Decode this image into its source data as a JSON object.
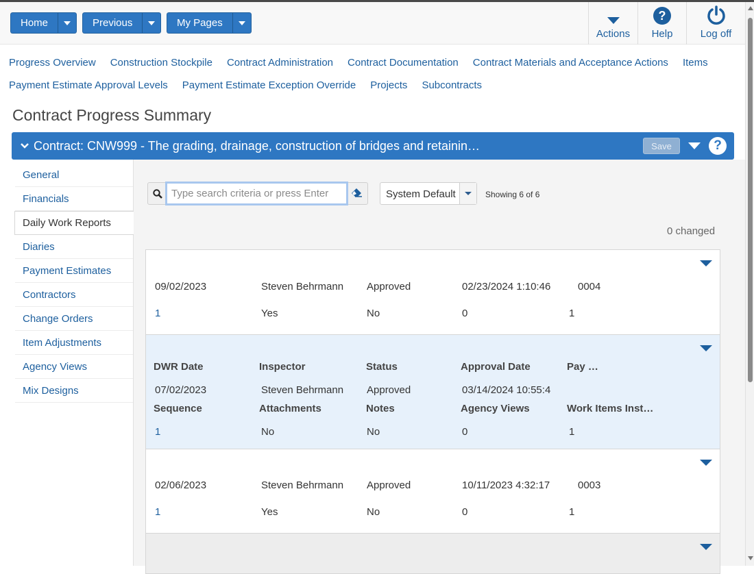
{
  "toolbar": {
    "home_label": "Home",
    "previous_label": "Previous",
    "my_pages_label": "My Pages",
    "actions_label": "Actions",
    "help_label": "Help",
    "logoff_label": "Log off"
  },
  "nav_links": {
    "row1": [
      "Progress Overview",
      "Construction Stockpile",
      "Contract Administration",
      "Contract Documentation",
      "Contract Materials and Acceptance Actions",
      "Items"
    ],
    "row2": [
      "Payment Estimate Approval Levels",
      "Payment Estimate Exception Override",
      "Projects",
      "Subcontracts"
    ]
  },
  "page_title": "Contract Progress Summary",
  "contract": {
    "title": "Contract: CNW999 - The grading, drainage, construction of bridges and retainin…",
    "save_label": "Save",
    "help_glyph": "?"
  },
  "sidebar": {
    "items": [
      "General",
      "Financials",
      "Daily Work Reports",
      "Diaries",
      "Payment Estimates",
      "Contractors",
      "Change Orders",
      "Item Adjustments",
      "Agency Views",
      "Mix Designs"
    ],
    "active": "Daily Work Reports"
  },
  "search": {
    "placeholder": "Type search criteria or press Enter",
    "value": ""
  },
  "view_select": {
    "value": "System Default"
  },
  "showing": "Showing 6 of 6",
  "changed": "0 changed",
  "headers": {
    "dwr_date": "DWR Date",
    "inspector": "Inspector",
    "status": "Status",
    "approval_date": "Approval Date",
    "pay": "Pay …",
    "sequence": "Sequence",
    "attachments": "Attachments",
    "notes": "Notes",
    "agency_views": "Agency Views",
    "work_items": "Work Items Inst…"
  },
  "rows": [
    {
      "dwr_date": "09/02/2023",
      "inspector": "Steven Behrmann",
      "status": "Approved",
      "approval_date": "02/23/2024 1:10:46",
      "pay": "0004",
      "sequence": "1",
      "attachments": "Yes",
      "notes": "No",
      "agency_views": "0",
      "work_items": "1"
    },
    {
      "dwr_date": "07/02/2023",
      "inspector": "Steven Behrmann",
      "status": "Approved",
      "approval_date": "03/14/2024 10:55:4",
      "pay": "",
      "sequence": "1",
      "attachments": "No",
      "notes": "No",
      "agency_views": "0",
      "work_items": "1"
    },
    {
      "dwr_date": "02/06/2023",
      "inspector": "Steven Behrmann",
      "status": "Approved",
      "approval_date": "10/11/2023 4:32:17",
      "pay": "0003",
      "sequence": "1",
      "attachments": "Yes",
      "notes": "No",
      "agency_views": "0",
      "work_items": "1"
    }
  ]
}
